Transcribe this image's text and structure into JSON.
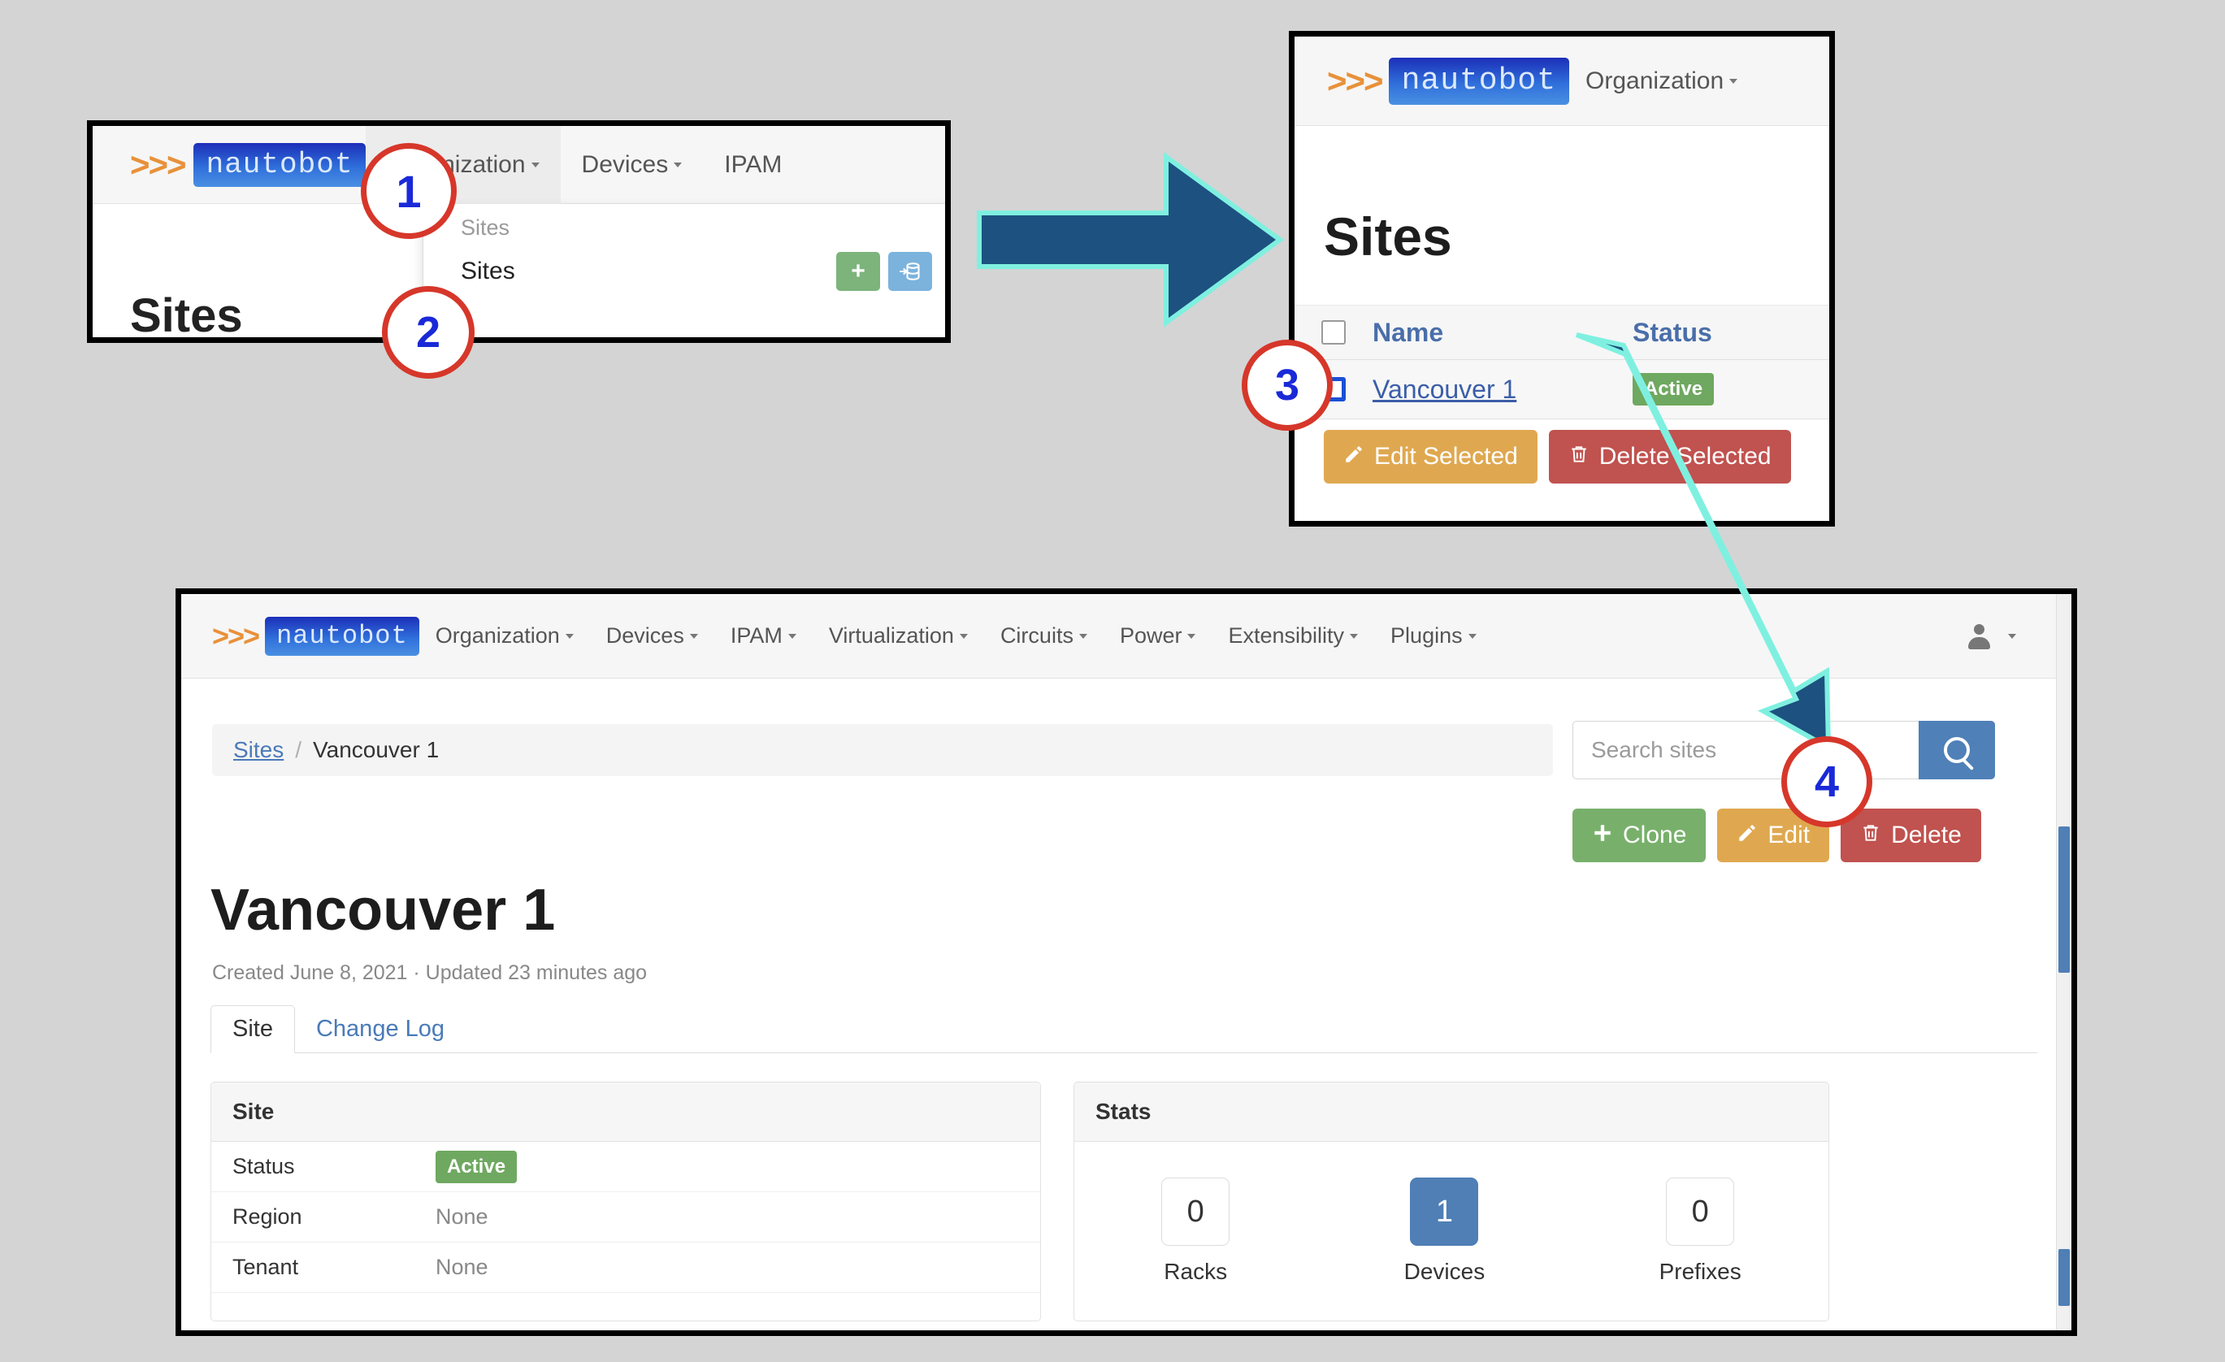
{
  "brand": {
    "chevrons": ">>>",
    "name": "nautobot"
  },
  "panel1": {
    "nav": [
      {
        "label": "Organization",
        "caret": true,
        "active": true
      },
      {
        "label": "Devices",
        "caret": true
      },
      {
        "label": "IPAM",
        "caret": false
      }
    ],
    "dropdown": {
      "header": "Sites",
      "item_label": "Sites",
      "add_icon": "plus-icon",
      "import_icon": "database-import-icon"
    },
    "page_title": "Sites"
  },
  "panel2": {
    "nav": [
      {
        "label": "Organization",
        "caret": true
      }
    ],
    "page_title": "Sites",
    "table": {
      "columns": [
        "Name",
        "Status"
      ],
      "rows": [
        {
          "name": "Vancouver 1",
          "status": "Active"
        }
      ]
    },
    "buttons": {
      "edit_selected": "Edit Selected",
      "delete_selected": "Delete Selected"
    }
  },
  "panel3": {
    "nav": [
      {
        "label": "Organization",
        "caret": true
      },
      {
        "label": "Devices",
        "caret": true
      },
      {
        "label": "IPAM",
        "caret": true
      },
      {
        "label": "Virtualization",
        "caret": true
      },
      {
        "label": "Circuits",
        "caret": true
      },
      {
        "label": "Power",
        "caret": true
      },
      {
        "label": "Extensibility",
        "caret": true
      },
      {
        "label": "Plugins",
        "caret": true
      }
    ],
    "breadcrumb": {
      "parent": "Sites",
      "separator": "/",
      "current": "Vancouver 1"
    },
    "search": {
      "placeholder": "Search sites",
      "button_icon": "search-icon"
    },
    "actions": [
      {
        "label": "Clone",
        "icon": "plus-icon",
        "color": "#78b06b"
      },
      {
        "label": "Edit",
        "icon": "pencil-icon",
        "color": "#dfa850"
      },
      {
        "label": "Delete",
        "icon": "trash-icon",
        "color": "#c0524f"
      }
    ],
    "page_title": "Vancouver 1",
    "meta": "Created June 8, 2021 · Updated 23 minutes ago",
    "tabs": [
      {
        "label": "Site",
        "active": true
      },
      {
        "label": "Change Log",
        "active": false
      }
    ],
    "site_card": {
      "title": "Site",
      "rows": [
        {
          "key": "Status",
          "value": "Active",
          "is_badge": true
        },
        {
          "key": "Region",
          "value": "None",
          "is_badge": false
        },
        {
          "key": "Tenant",
          "value": "None",
          "is_badge": false
        }
      ]
    },
    "stats_card": {
      "title": "Stats",
      "stats": [
        {
          "value": "0",
          "label": "Racks",
          "filled": false
        },
        {
          "value": "1",
          "label": "Devices",
          "filled": true
        },
        {
          "value": "0",
          "label": "Prefixes",
          "filled": false
        }
      ]
    }
  },
  "callouts": [
    {
      "number": "1"
    },
    {
      "number": "2"
    },
    {
      "number": "3"
    },
    {
      "number": "4"
    }
  ],
  "colors": {
    "arrow_fill": "#1d5180",
    "arrow_outline": "#7ff0e0",
    "callout_ring": "#d6372a",
    "callout_number": "#1a29d8",
    "brand_orange": "#e8913a",
    "status_green": "#6fa860",
    "page_bg": "#d4d4d4"
  }
}
